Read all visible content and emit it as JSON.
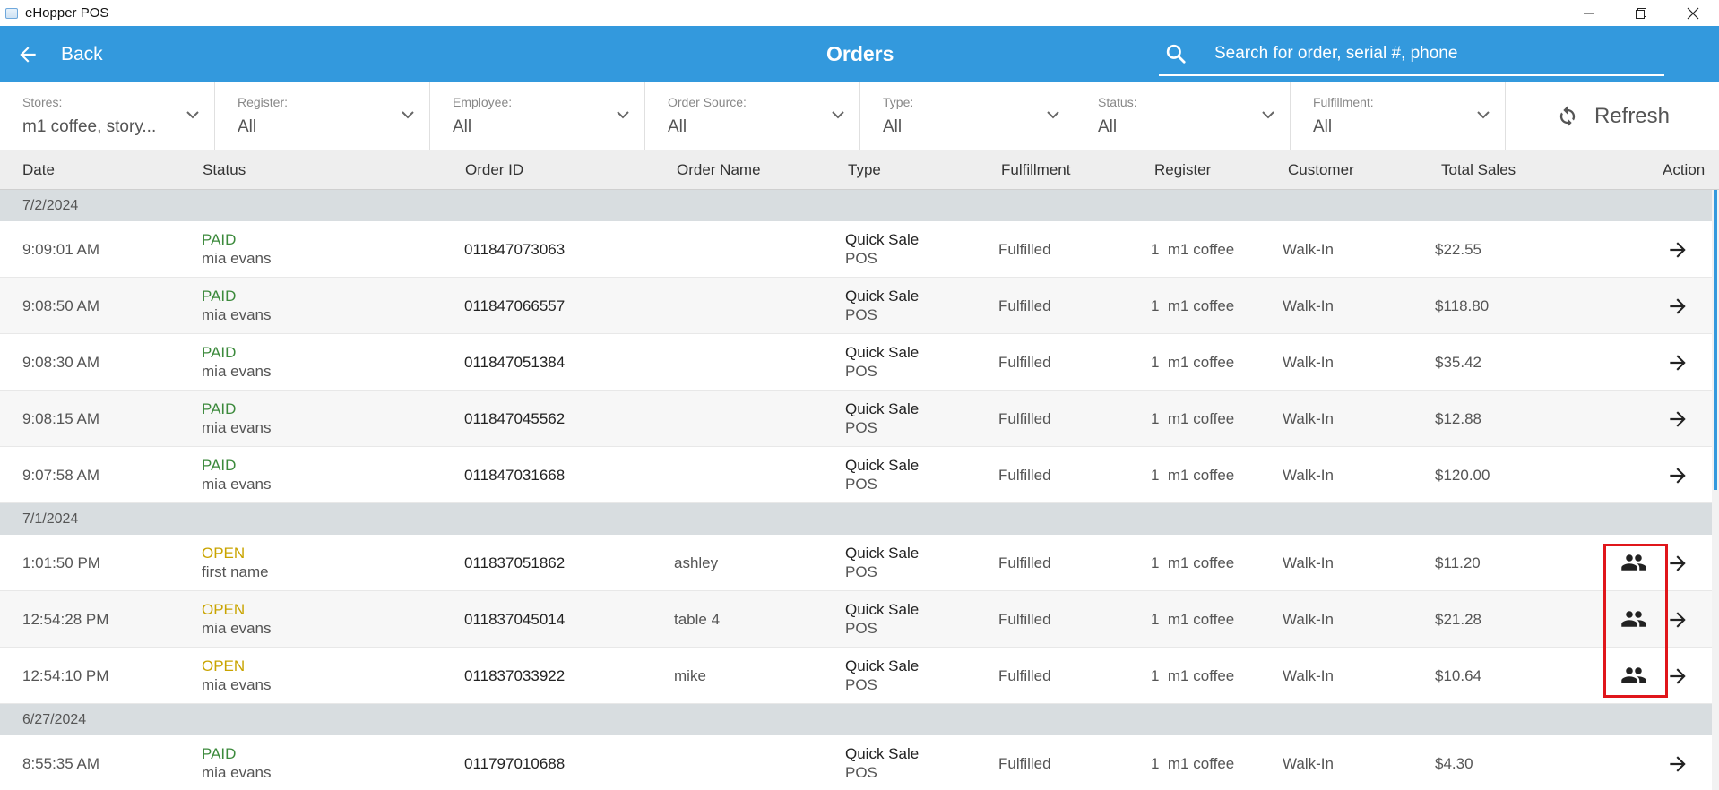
{
  "window": {
    "title": "eHopper POS"
  },
  "header": {
    "back_label": "Back",
    "title": "Orders",
    "search_placeholder": "Search for order, serial #, phone"
  },
  "filters": [
    {
      "label": "Stores:",
      "value": "m1 coffee, story..."
    },
    {
      "label": "Register:",
      "value": "All"
    },
    {
      "label": "Employee:",
      "value": "All"
    },
    {
      "label": "Order Source:",
      "value": "All"
    },
    {
      "label": "Type:",
      "value": "All"
    },
    {
      "label": "Status:",
      "value": "All"
    },
    {
      "label": "Fulfillment:",
      "value": "All"
    }
  ],
  "refresh_label": "Refresh",
  "columns": [
    "Date",
    "Status",
    "Order ID",
    "Order Name",
    "Type",
    "Fulfillment",
    "Register",
    "Customer",
    "Total Sales",
    "Action"
  ],
  "groups": [
    {
      "date": "7/2/2024",
      "rows": [
        {
          "time": "9:09:01 AM",
          "status": "PAID",
          "employee": "mia evans",
          "order_id": "011847073063",
          "order_name": "",
          "type": "Quick Sale",
          "source": "POS",
          "fulfillment": "Fulfilled",
          "register": "1  m1 coffee",
          "customer": "Walk-In",
          "total": "$22.55",
          "guest_icon": false
        },
        {
          "time": "9:08:50 AM",
          "status": "PAID",
          "employee": "mia evans",
          "order_id": "011847066557",
          "order_name": "",
          "type": "Quick Sale",
          "source": "POS",
          "fulfillment": "Fulfilled",
          "register": "1  m1 coffee",
          "customer": "Walk-In",
          "total": "$118.80",
          "guest_icon": false
        },
        {
          "time": "9:08:30 AM",
          "status": "PAID",
          "employee": "mia evans",
          "order_id": "011847051384",
          "order_name": "",
          "type": "Quick Sale",
          "source": "POS",
          "fulfillment": "Fulfilled",
          "register": "1  m1 coffee",
          "customer": "Walk-In",
          "total": "$35.42",
          "guest_icon": false
        },
        {
          "time": "9:08:15 AM",
          "status": "PAID",
          "employee": "mia evans",
          "order_id": "011847045562",
          "order_name": "",
          "type": "Quick Sale",
          "source": "POS",
          "fulfillment": "Fulfilled",
          "register": "1  m1 coffee",
          "customer": "Walk-In",
          "total": "$12.88",
          "guest_icon": false
        },
        {
          "time": "9:07:58 AM",
          "status": "PAID",
          "employee": "mia evans",
          "order_id": "011847031668",
          "order_name": "",
          "type": "Quick Sale",
          "source": "POS",
          "fulfillment": "Fulfilled",
          "register": "1  m1 coffee",
          "customer": "Walk-In",
          "total": "$120.00",
          "guest_icon": false
        }
      ]
    },
    {
      "date": "7/1/2024",
      "rows": [
        {
          "time": "1:01:50 PM",
          "status": "OPEN",
          "employee": "first name",
          "order_id": "011837051862",
          "order_name": "ashley",
          "type": "Quick Sale",
          "source": "POS",
          "fulfillment": "Fulfilled",
          "register": "1  m1 coffee",
          "customer": "Walk-In",
          "total": "$11.20",
          "guest_icon": true
        },
        {
          "time": "12:54:28 PM",
          "status": "OPEN",
          "employee": "mia evans",
          "order_id": "011837045014",
          "order_name": "table 4",
          "type": "Quick Sale",
          "source": "POS",
          "fulfillment": "Fulfilled",
          "register": "1  m1 coffee",
          "customer": "Walk-In",
          "total": "$21.28",
          "guest_icon": true
        },
        {
          "time": "12:54:10 PM",
          "status": "OPEN",
          "employee": "mia evans",
          "order_id": "011837033922",
          "order_name": "mike",
          "type": "Quick Sale",
          "source": "POS",
          "fulfillment": "Fulfilled",
          "register": "1  m1 coffee",
          "customer": "Walk-In",
          "total": "$10.64",
          "guest_icon": true
        }
      ]
    },
    {
      "date": "6/27/2024",
      "rows": [
        {
          "time": "8:55:35 AM",
          "status": "PAID",
          "employee": "mia evans",
          "order_id": "011797010688",
          "order_name": "",
          "type": "Quick Sale",
          "source": "POS",
          "fulfillment": "Fulfilled",
          "register": "1  m1 coffee",
          "customer": "Walk-In",
          "total": "$4.30",
          "guest_icon": false
        }
      ]
    }
  ],
  "colors": {
    "header": "#3399dd",
    "paid": "#3c8a3c",
    "open": "#c9a400",
    "highlight": "#e0161b"
  }
}
